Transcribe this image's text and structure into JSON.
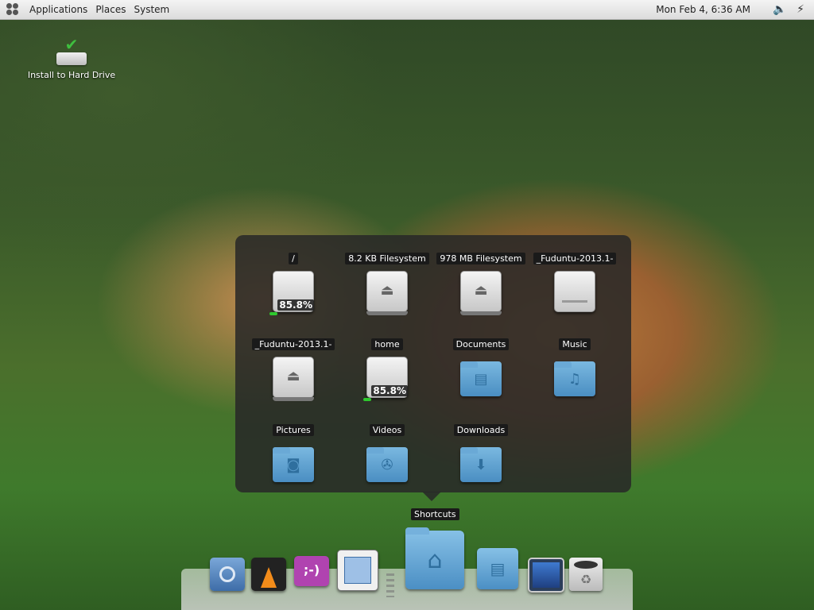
{
  "top_panel": {
    "menus": [
      "Applications",
      "Places",
      "System"
    ],
    "clock": "Mon Feb  4,  6:36 AM",
    "tray": [
      {
        "name": "volume-icon",
        "glyph": "🔈"
      },
      {
        "name": "network-icon",
        "glyph": "⚡"
      }
    ]
  },
  "desktop": {
    "icons": [
      {
        "label": "Install to Hard Drive",
        "icon": "install-drive-icon"
      }
    ]
  },
  "stack": {
    "title": "Shortcuts",
    "items": [
      {
        "label": "/",
        "type": "drive",
        "usage": "85.8%"
      },
      {
        "label": "8.2 KB Filesystem",
        "type": "removable"
      },
      {
        "label": "978 MB Filesystem",
        "type": "removable"
      },
      {
        "label": "_Fuduntu-2013.1-",
        "type": "hdd"
      },
      {
        "label": "_Fuduntu-2013.1-",
        "type": "removable"
      },
      {
        "label": "home",
        "type": "drive",
        "usage": "85.8%"
      },
      {
        "label": "Documents",
        "type": "folder",
        "emblem": "document-icon"
      },
      {
        "label": "Music",
        "type": "folder",
        "emblem": "music-note-icon"
      },
      {
        "label": "Pictures",
        "type": "folder",
        "emblem": "camera-icon"
      },
      {
        "label": "Videos",
        "type": "folder",
        "emblem": "film-reel-icon"
      },
      {
        "label": "Downloads",
        "type": "folder",
        "emblem": "download-arrow-icon"
      }
    ]
  },
  "dock": {
    "items": [
      {
        "name": "chromium-icon"
      },
      {
        "name": "vlc-icon"
      },
      {
        "name": "pidgin-icon",
        "glyph": ";-)"
      },
      {
        "name": "libreoffice-impress-icon"
      },
      {
        "name": "home-folder-icon"
      },
      {
        "name": "documents-folder-icon"
      },
      {
        "name": "screenshot-tool-icon"
      },
      {
        "name": "trash-icon"
      }
    ]
  },
  "colors": {
    "folder": "#5a9fd0",
    "usage_bar": "#2ec82e",
    "stack_bg": "#282828"
  }
}
